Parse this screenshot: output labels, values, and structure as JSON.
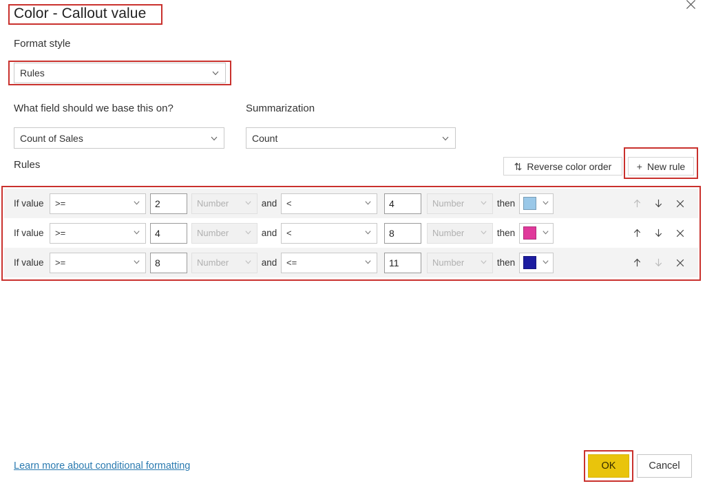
{
  "dialog": {
    "title": "Color - Callout value",
    "close_icon": "close-icon"
  },
  "format_style": {
    "label": "Format style",
    "value": "Rules",
    "chevron_icon": "chevron-down-icon"
  },
  "base_field": {
    "label": "What field should we base this on?",
    "value": "Count of Sales"
  },
  "summarization": {
    "label": "Summarization",
    "value": "Count"
  },
  "rules_section": {
    "label": "Rules",
    "reverse_button": {
      "label": "Reverse color order",
      "icon": "sort-arrows-icon",
      "glyph": "⇅"
    },
    "new_rule_button": {
      "label": "New rule",
      "icon": "plus-icon",
      "glyph": "+"
    },
    "if_value_label": "If value",
    "and_label": "and",
    "then_label": "then",
    "unit_placeholder": "Number",
    "rows": [
      {
        "op1": ">=",
        "val1": "2",
        "unit1": "Number",
        "op2": "<",
        "val2": "4",
        "unit2": "Number",
        "color": "#9ac8e8",
        "color_name": "light-blue",
        "move_up_enabled": false,
        "move_down_enabled": true
      },
      {
        "op1": ">=",
        "val1": "4",
        "unit1": "Number",
        "op2": "<",
        "val2": "8",
        "unit2": "Number",
        "color": "#e0399b",
        "color_name": "magenta",
        "move_up_enabled": true,
        "move_down_enabled": true
      },
      {
        "op1": ">=",
        "val1": "8",
        "unit1": "Number",
        "op2": "<=",
        "val2": "11",
        "unit2": "Number",
        "color": "#1c1ca0",
        "color_name": "navy-blue",
        "move_up_enabled": true,
        "move_down_enabled": false
      }
    ],
    "move_up_icon": "arrow-up-icon",
    "move_down_icon": "arrow-down-icon",
    "delete_icon": "close-x-icon"
  },
  "footer": {
    "learn_more_link": "Learn more about conditional formatting",
    "ok_label": "OK",
    "cancel_label": "Cancel"
  },
  "colors": {
    "accent_ok": "#e9c40c",
    "annotation": "#c9302c",
    "link": "#2a7ab0"
  }
}
